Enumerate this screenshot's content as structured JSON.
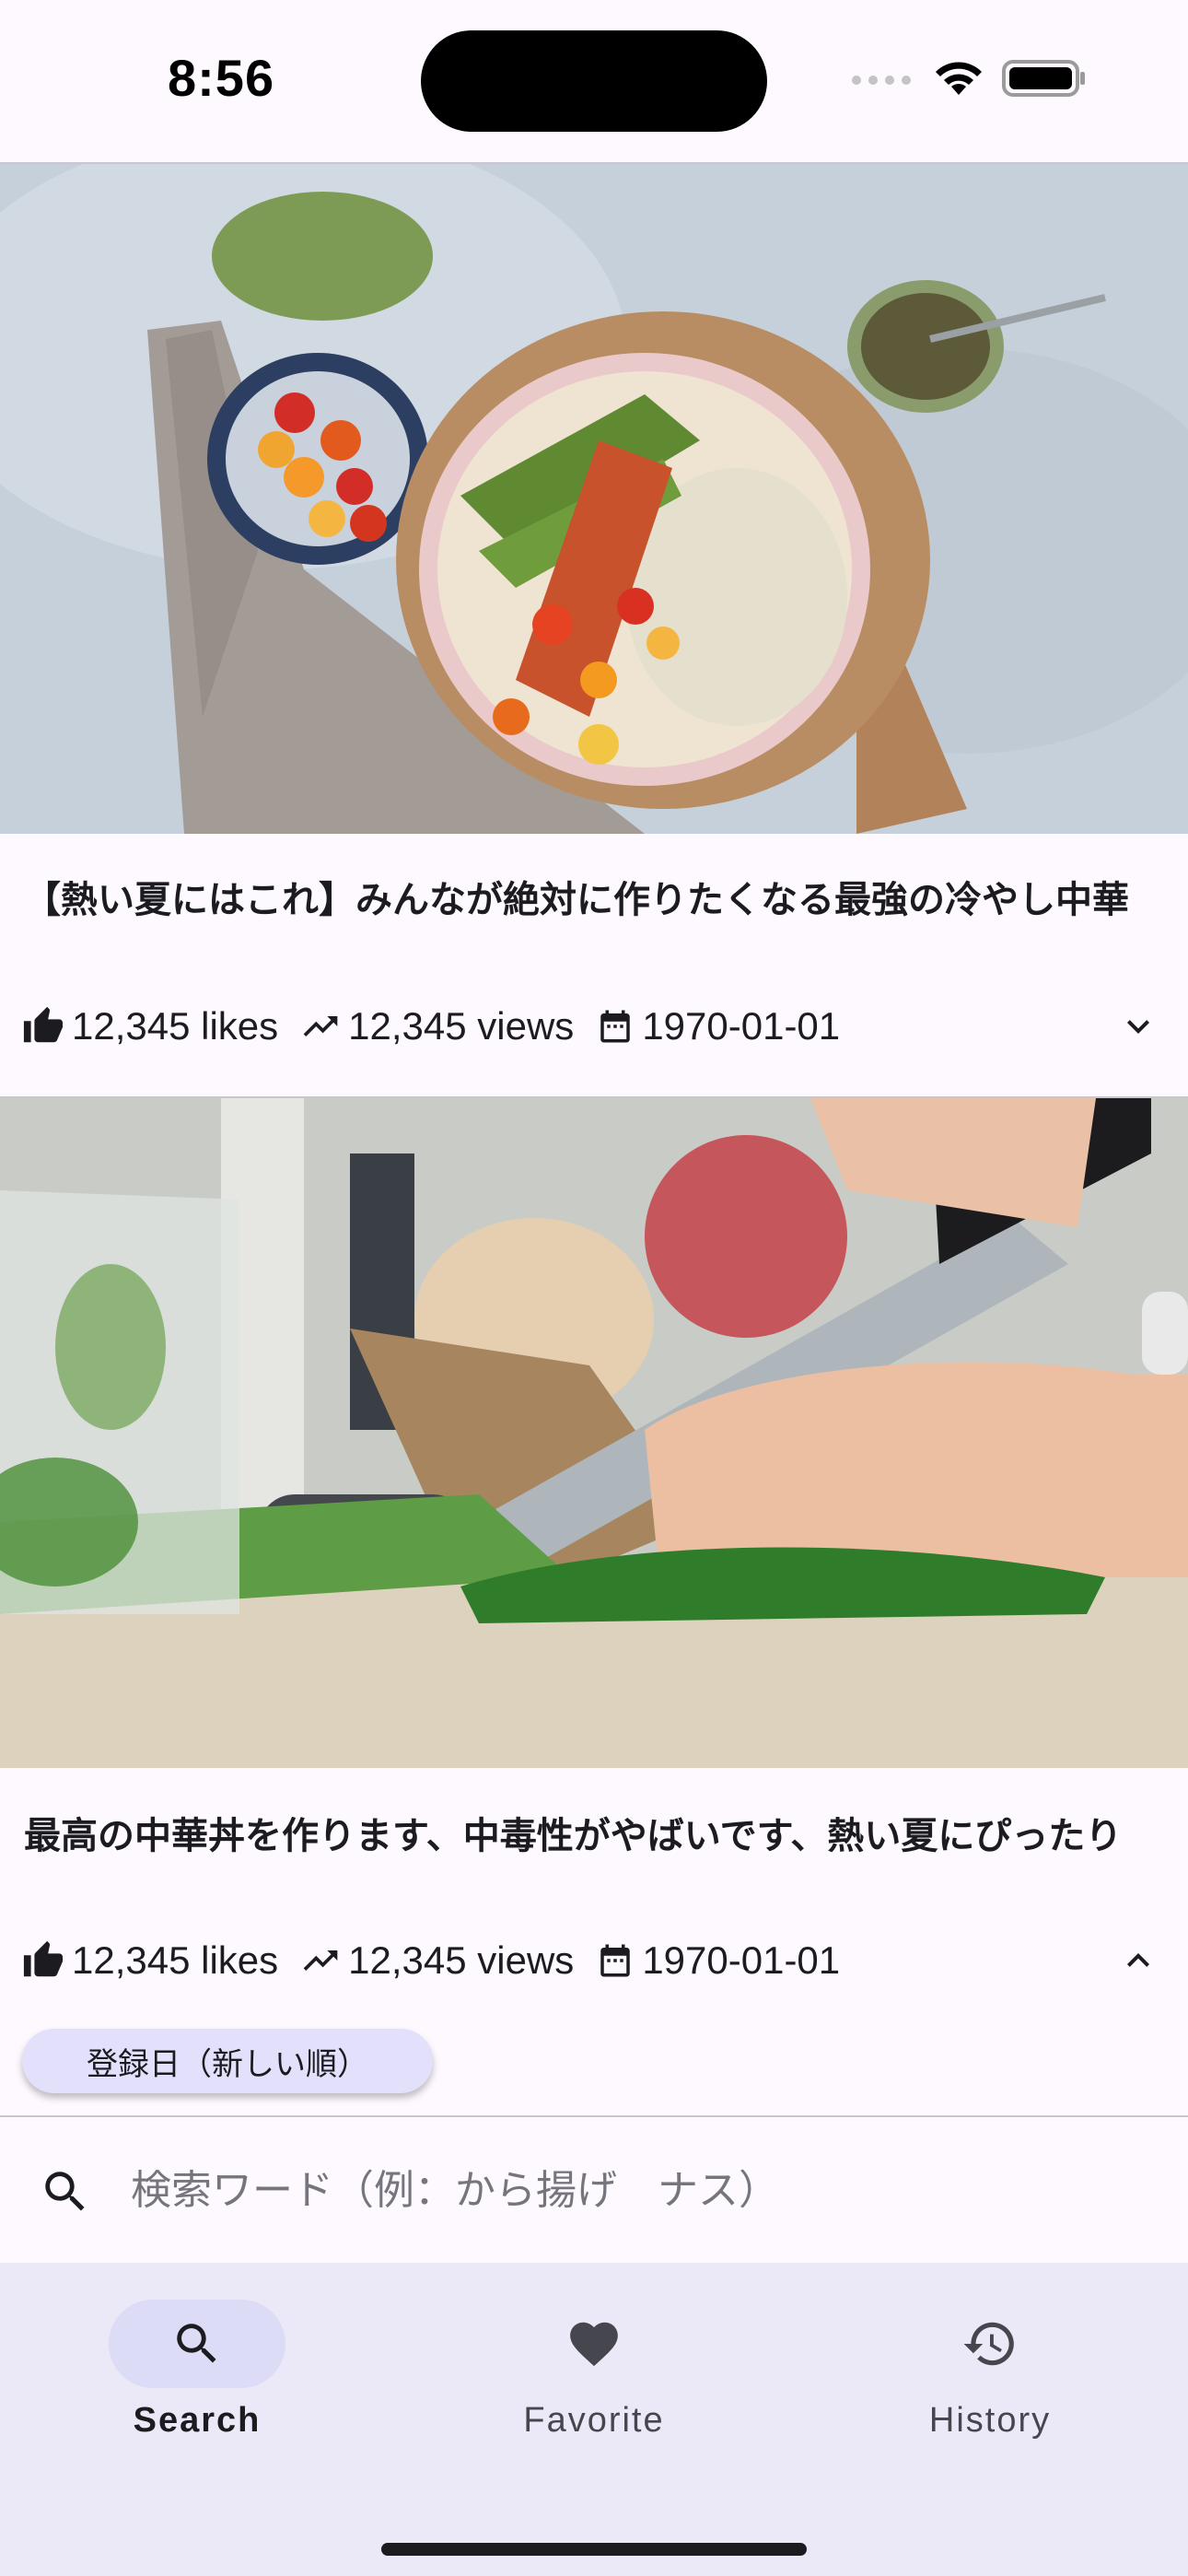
{
  "status_bar": {
    "time": "8:56"
  },
  "posts": [
    {
      "title": "【熱い夏にはこれ】みんなが絶対に作りたくなる最強の冷やし中華",
      "likes": "12,345 likes",
      "views": "12,345 views",
      "date": "1970-01-01",
      "expanded": false,
      "image_icon": "food-plate-photo"
    },
    {
      "title": "最高の中華丼を作ります、中毒性がやばいです、熱い夏にぴったり",
      "likes": "12,345 likes",
      "views": "12,345 views",
      "date": "1970-01-01",
      "expanded": true,
      "image_icon": "chopping-herbs-photo"
    }
  ],
  "sort": {
    "label": "登録日（新しい順）"
  },
  "search": {
    "placeholder": "検索ワード（例：から揚げ　ナス）",
    "value": ""
  },
  "nav": {
    "items": [
      {
        "label": "Search",
        "icon": "search-icon",
        "active": true
      },
      {
        "label": "Favorite",
        "icon": "heart-icon",
        "active": false
      },
      {
        "label": "History",
        "icon": "history-icon",
        "active": false
      }
    ]
  },
  "colors": {
    "background": "#fdf9ff",
    "nav_background": "#ebe9f7",
    "active_indicator": "#dcdcf7",
    "chip": "#e2e0fa",
    "text": "#1b1b20"
  }
}
